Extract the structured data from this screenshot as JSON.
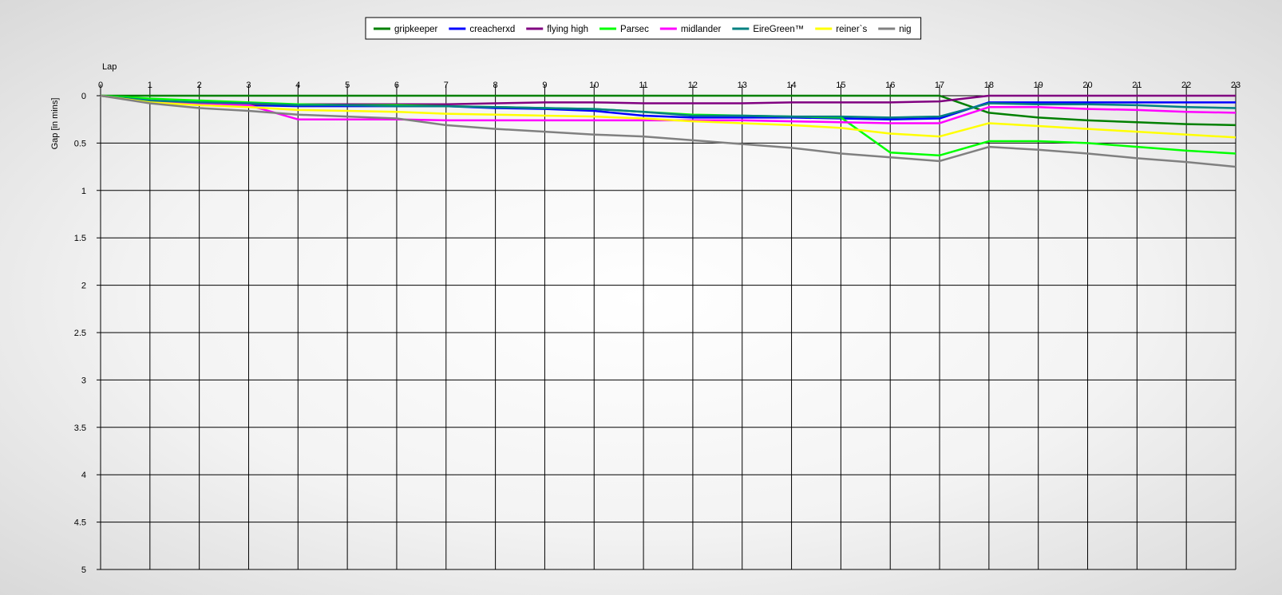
{
  "chart_data": {
    "type": "line",
    "xlabel": "Lap",
    "ylabel": "Gap [in mins]",
    "xlim": [
      0,
      23
    ],
    "ylim": [
      0,
      5
    ],
    "y_inverted": true,
    "x_ticks": [
      "0",
      "1",
      "2",
      "3",
      "4",
      "5",
      "6",
      "7",
      "8",
      "9",
      "10",
      "11",
      "12",
      "13",
      "14",
      "15",
      "16",
      "17",
      "18",
      "19",
      "20",
      "21",
      "22",
      "23"
    ],
    "y_ticks": [
      "0",
      "0.5",
      "1",
      "1.5",
      "2",
      "2.5",
      "3",
      "3.5",
      "4",
      "4.5",
      "5"
    ],
    "y_tick_values": [
      0,
      0.5,
      1,
      1.5,
      2,
      2.5,
      3,
      3.5,
      4,
      4.5,
      5
    ],
    "grid": true,
    "legend_position": "top-center",
    "x": [
      0,
      1,
      2,
      3,
      4,
      5,
      6,
      7,
      8,
      9,
      10,
      11,
      12,
      13,
      14,
      15,
      16,
      17,
      18,
      19,
      20,
      21,
      22,
      23
    ],
    "series": [
      {
        "name": "gripkeeper",
        "color": "#008000",
        "values": [
          0,
          0,
          0,
          0,
          0,
          0,
          0,
          0,
          0,
          0,
          0,
          0,
          0,
          0,
          0,
          0,
          0,
          0,
          0.18,
          0.23,
          0.26,
          0.28,
          0.3,
          0.31
        ]
      },
      {
        "name": "creacherxd",
        "color": "#0000FF",
        "values": [
          0,
          0.06,
          0.08,
          0.1,
          0.11,
          0.11,
          0.11,
          0.11,
          0.13,
          0.14,
          0.16,
          0.21,
          0.23,
          0.23,
          0.23,
          0.24,
          0.25,
          0.24,
          0.07,
          0.07,
          0.07,
          0.07,
          0.07,
          0.07
        ]
      },
      {
        "name": "flying high",
        "color": "#800080",
        "values": [
          0,
          0.06,
          0.08,
          0.09,
          0.09,
          0.09,
          0.09,
          0.09,
          0.08,
          0.07,
          0.07,
          0.08,
          0.08,
          0.08,
          0.07,
          0.07,
          0.07,
          0.06,
          0,
          0,
          0,
          0,
          0,
          0
        ]
      },
      {
        "name": "Parsec",
        "color": "#00FF00",
        "values": [
          0,
          0.03,
          0.05,
          0.07,
          0.09,
          0.1,
          0.1,
          0.11,
          0.12,
          0.13,
          0.14,
          0.17,
          0.2,
          0.21,
          0.22,
          0.23,
          0.6,
          0.63,
          0.48,
          0.48,
          0.5,
          0.54,
          0.58,
          0.61
        ]
      },
      {
        "name": "midlander",
        "color": "#FF00FF",
        "values": [
          0,
          0.06,
          0.08,
          0.1,
          0.25,
          0.25,
          0.25,
          0.26,
          0.26,
          0.26,
          0.26,
          0.26,
          0.26,
          0.26,
          0.27,
          0.28,
          0.29,
          0.29,
          0.12,
          0.12,
          0.14,
          0.15,
          0.17,
          0.18
        ]
      },
      {
        "name": "EireGreen™",
        "color": "#008080",
        "values": [
          0,
          0.05,
          0.07,
          0.08,
          0.1,
          0.1,
          0.11,
          0.11,
          0.12,
          0.13,
          0.14,
          0.17,
          0.21,
          0.21,
          0.22,
          0.22,
          0.23,
          0.22,
          0.08,
          0.09,
          0.09,
          0.1,
          0.12,
          0.13
        ]
      },
      {
        "name": "reiner`s",
        "color": "#FFFF00",
        "values": [
          0,
          0.07,
          0.1,
          0.12,
          0.15,
          0.16,
          0.17,
          0.19,
          0.2,
          0.21,
          0.22,
          0.24,
          0.27,
          0.29,
          0.31,
          0.34,
          0.4,
          0.43,
          0.29,
          0.32,
          0.35,
          0.38,
          0.41,
          0.44
        ]
      },
      {
        "name": "nig",
        "color": "#808080",
        "values": [
          0,
          0.08,
          0.13,
          0.16,
          0.2,
          0.22,
          0.24,
          0.31,
          0.35,
          0.38,
          0.41,
          0.43,
          0.47,
          0.51,
          0.55,
          0.61,
          0.65,
          0.69,
          0.54,
          0.57,
          0.61,
          0.66,
          0.7,
          0.75
        ]
      }
    ]
  }
}
